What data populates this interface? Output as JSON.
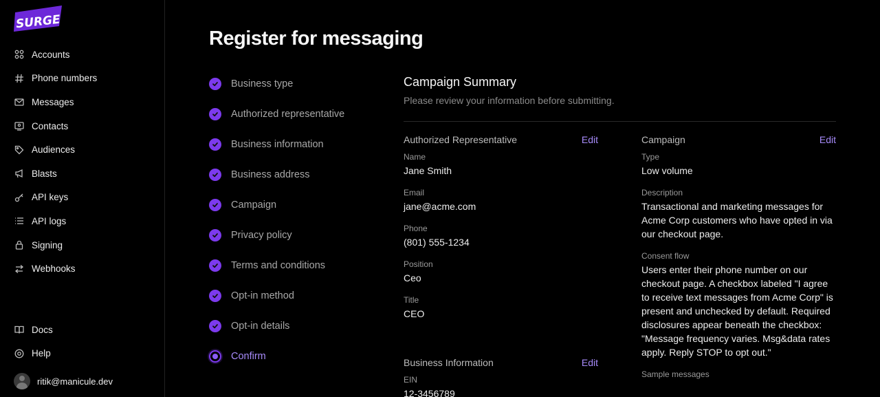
{
  "brand": {
    "logo_text": "SURGE",
    "accent": "#6d28d9"
  },
  "sidebar": {
    "items": [
      {
        "label": "Accounts",
        "icon": "accounts-icon"
      },
      {
        "label": "Phone numbers",
        "icon": "hash-icon"
      },
      {
        "label": "Messages",
        "icon": "envelope-icon"
      },
      {
        "label": "Contacts",
        "icon": "contacts-icon"
      },
      {
        "label": "Audiences",
        "icon": "tag-icon"
      },
      {
        "label": "Blasts",
        "icon": "megaphone-icon"
      },
      {
        "label": "API keys",
        "icon": "key-icon"
      },
      {
        "label": "API logs",
        "icon": "list-icon"
      },
      {
        "label": "Signing",
        "icon": "lock-icon"
      },
      {
        "label": "Webhooks",
        "icon": "webhooks-icon"
      }
    ],
    "bottom": [
      {
        "label": "Docs",
        "icon": "book-icon"
      },
      {
        "label": "Help",
        "icon": "help-icon"
      }
    ],
    "user": {
      "email": "ritik@manicule.dev"
    }
  },
  "page": {
    "title": "Register for messaging"
  },
  "steps": [
    {
      "label": "Business type",
      "state": "done"
    },
    {
      "label": "Authorized representative",
      "state": "done"
    },
    {
      "label": "Business information",
      "state": "done"
    },
    {
      "label": "Business address",
      "state": "done"
    },
    {
      "label": "Campaign",
      "state": "done"
    },
    {
      "label": "Privacy policy",
      "state": "done"
    },
    {
      "label": "Terms and conditions",
      "state": "done"
    },
    {
      "label": "Opt-in method",
      "state": "done"
    },
    {
      "label": "Opt-in details",
      "state": "done"
    },
    {
      "label": "Confirm",
      "state": "current"
    }
  ],
  "summary": {
    "title": "Campaign Summary",
    "subtitle": "Please review your information before submitting.",
    "edit_label": "Edit",
    "authorized_rep": {
      "heading": "Authorized Representative",
      "fields": [
        {
          "k": "Name",
          "v": "Jane Smith"
        },
        {
          "k": "Email",
          "v": "jane@acme.com"
        },
        {
          "k": "Phone",
          "v": "(801) 555-1234"
        },
        {
          "k": "Position",
          "v": "Ceo"
        },
        {
          "k": "Title",
          "v": "CEO"
        }
      ]
    },
    "business_info": {
      "heading": "Business Information",
      "fields": [
        {
          "k": "EIN",
          "v": "12-3456789"
        }
      ]
    },
    "campaign": {
      "heading": "Campaign",
      "fields": [
        {
          "k": "Type",
          "v": "Low volume"
        },
        {
          "k": "Description",
          "v": "Transactional and marketing messages for Acme Corp customers who have opted in via our checkout page."
        },
        {
          "k": "Consent flow",
          "v": "Users enter their phone number on our checkout page. A checkbox labeled \"I agree to receive text messages from Acme Corp\" is present and unchecked by default. Required disclosures appear beneath the checkbox: \"Message frequency varies. Msg&data rates apply. Reply STOP to opt out.\""
        },
        {
          "k": "Sample messages",
          "v": ""
        }
      ]
    }
  }
}
